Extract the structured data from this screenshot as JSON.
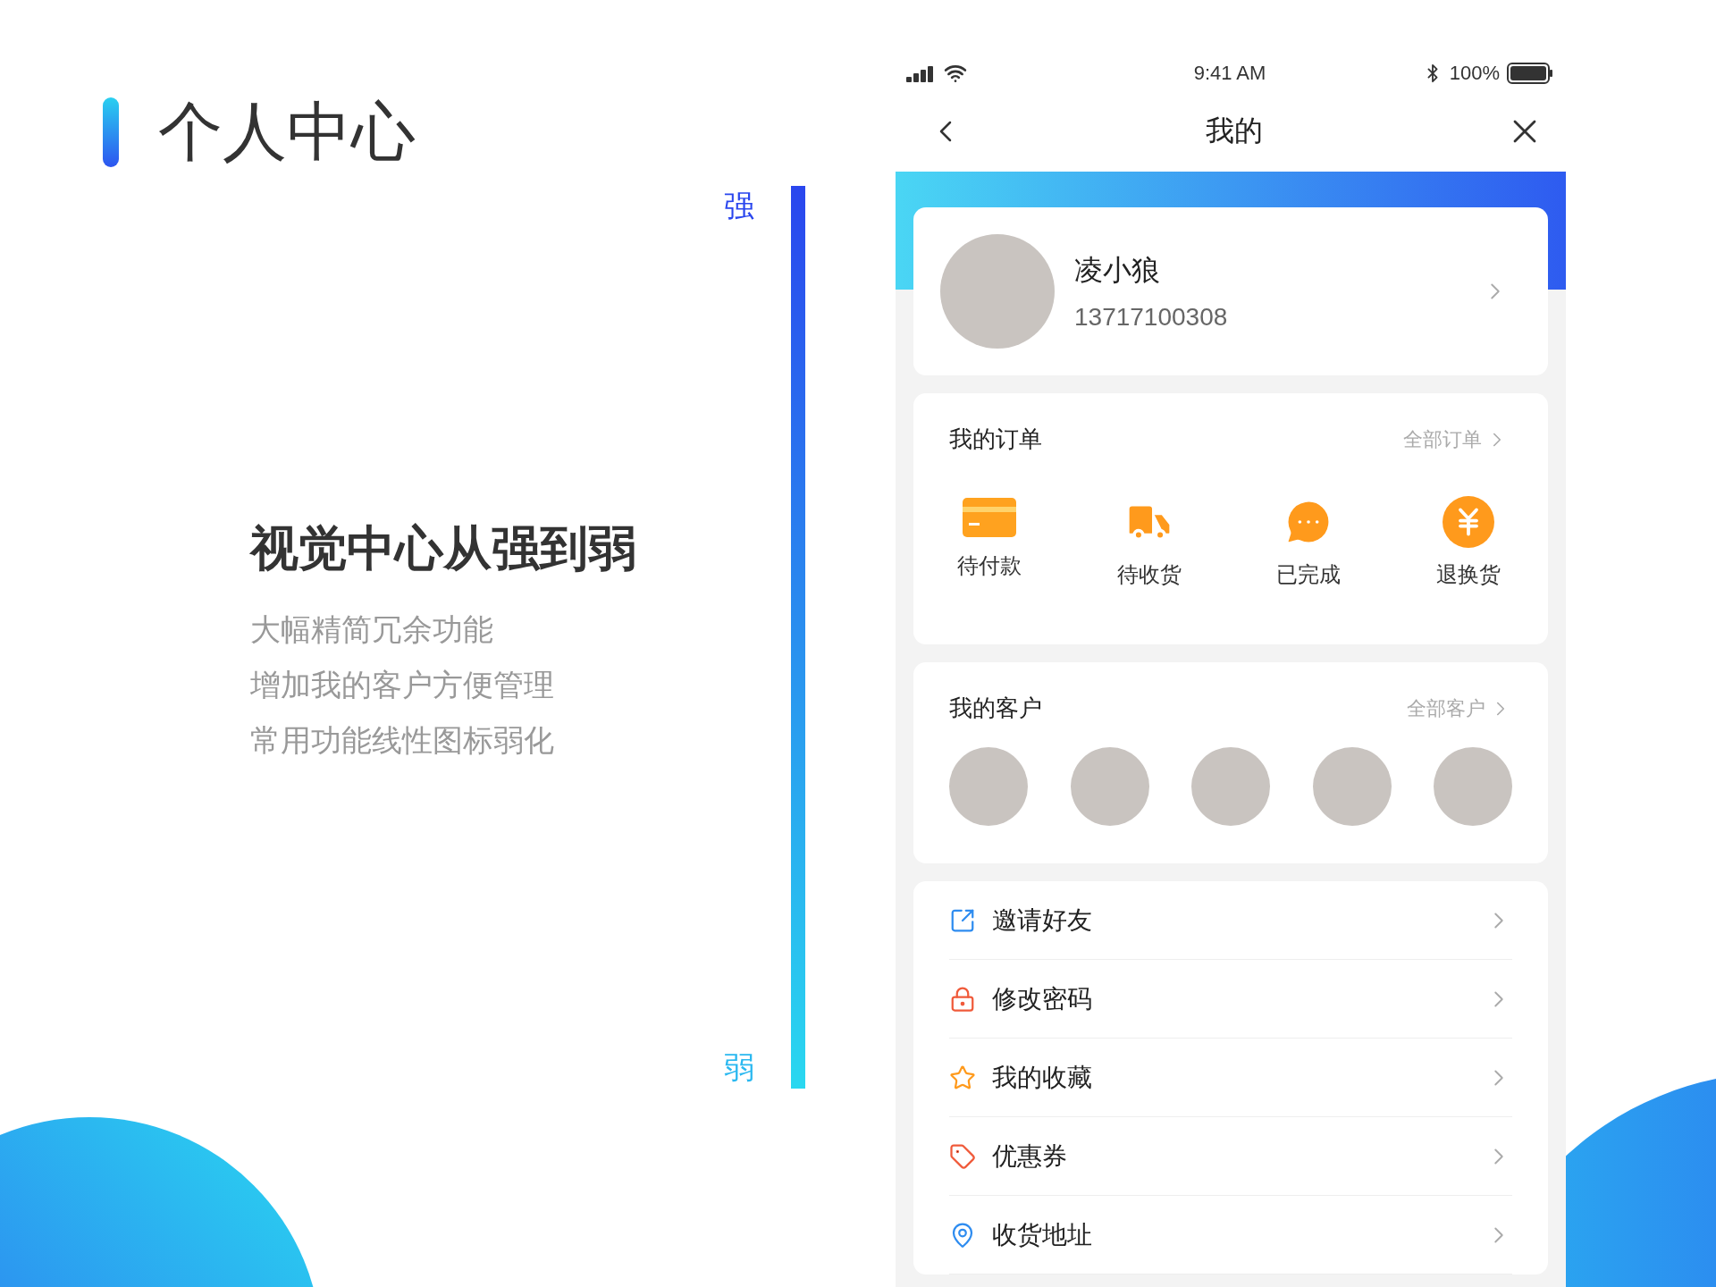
{
  "slide": {
    "title": "个人中心",
    "heading": "视觉中心从强到弱",
    "points": [
      "大幅精简冗余功能",
      "增加我的客户方便管理",
      "常用功能线性图标弱化"
    ],
    "scale": {
      "top": "强",
      "bottom": "弱"
    }
  },
  "phone": {
    "status_bar": {
      "time": "9:41 AM",
      "battery": "100%"
    },
    "nav": {
      "title": "我的"
    },
    "profile": {
      "name": "凌小狼",
      "phone": "13717100308"
    },
    "orders": {
      "title": "我的订单",
      "link": "全部订单",
      "items": [
        {
          "label": "待付款",
          "kind": "card"
        },
        {
          "label": "待收货",
          "kind": "truck"
        },
        {
          "label": "已完成",
          "kind": "chat"
        },
        {
          "label": "退换货",
          "kind": "yen"
        }
      ]
    },
    "customers": {
      "title": "我的客户",
      "link": "全部客户"
    },
    "menu": [
      {
        "label": "邀请好友",
        "kind": "share"
      },
      {
        "label": "修改密码",
        "kind": "lock"
      },
      {
        "label": "我的收藏",
        "kind": "star"
      },
      {
        "label": "优惠券",
        "kind": "tag"
      },
      {
        "label": "收货地址",
        "kind": "pin"
      }
    ]
  }
}
